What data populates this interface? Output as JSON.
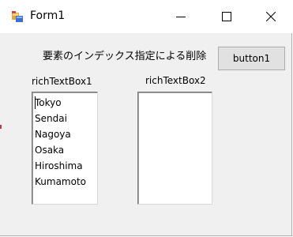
{
  "window": {
    "title": "Form1"
  },
  "titlebar": {
    "minimize_icon": "minimize-icon",
    "maximize_icon": "maximize-icon",
    "close_icon": "close-icon"
  },
  "form": {
    "heading": "要素のインデックス指定による削除",
    "button_label": "button1",
    "richtextbox1": {
      "label": "richTextBox1",
      "lines": [
        "Tokyo",
        "Sendai",
        "Nagoya",
        "Osaka",
        "Hiroshima",
        "Kumamoto"
      ]
    },
    "richtextbox2": {
      "label": "richTextBox2",
      "lines": []
    }
  }
}
